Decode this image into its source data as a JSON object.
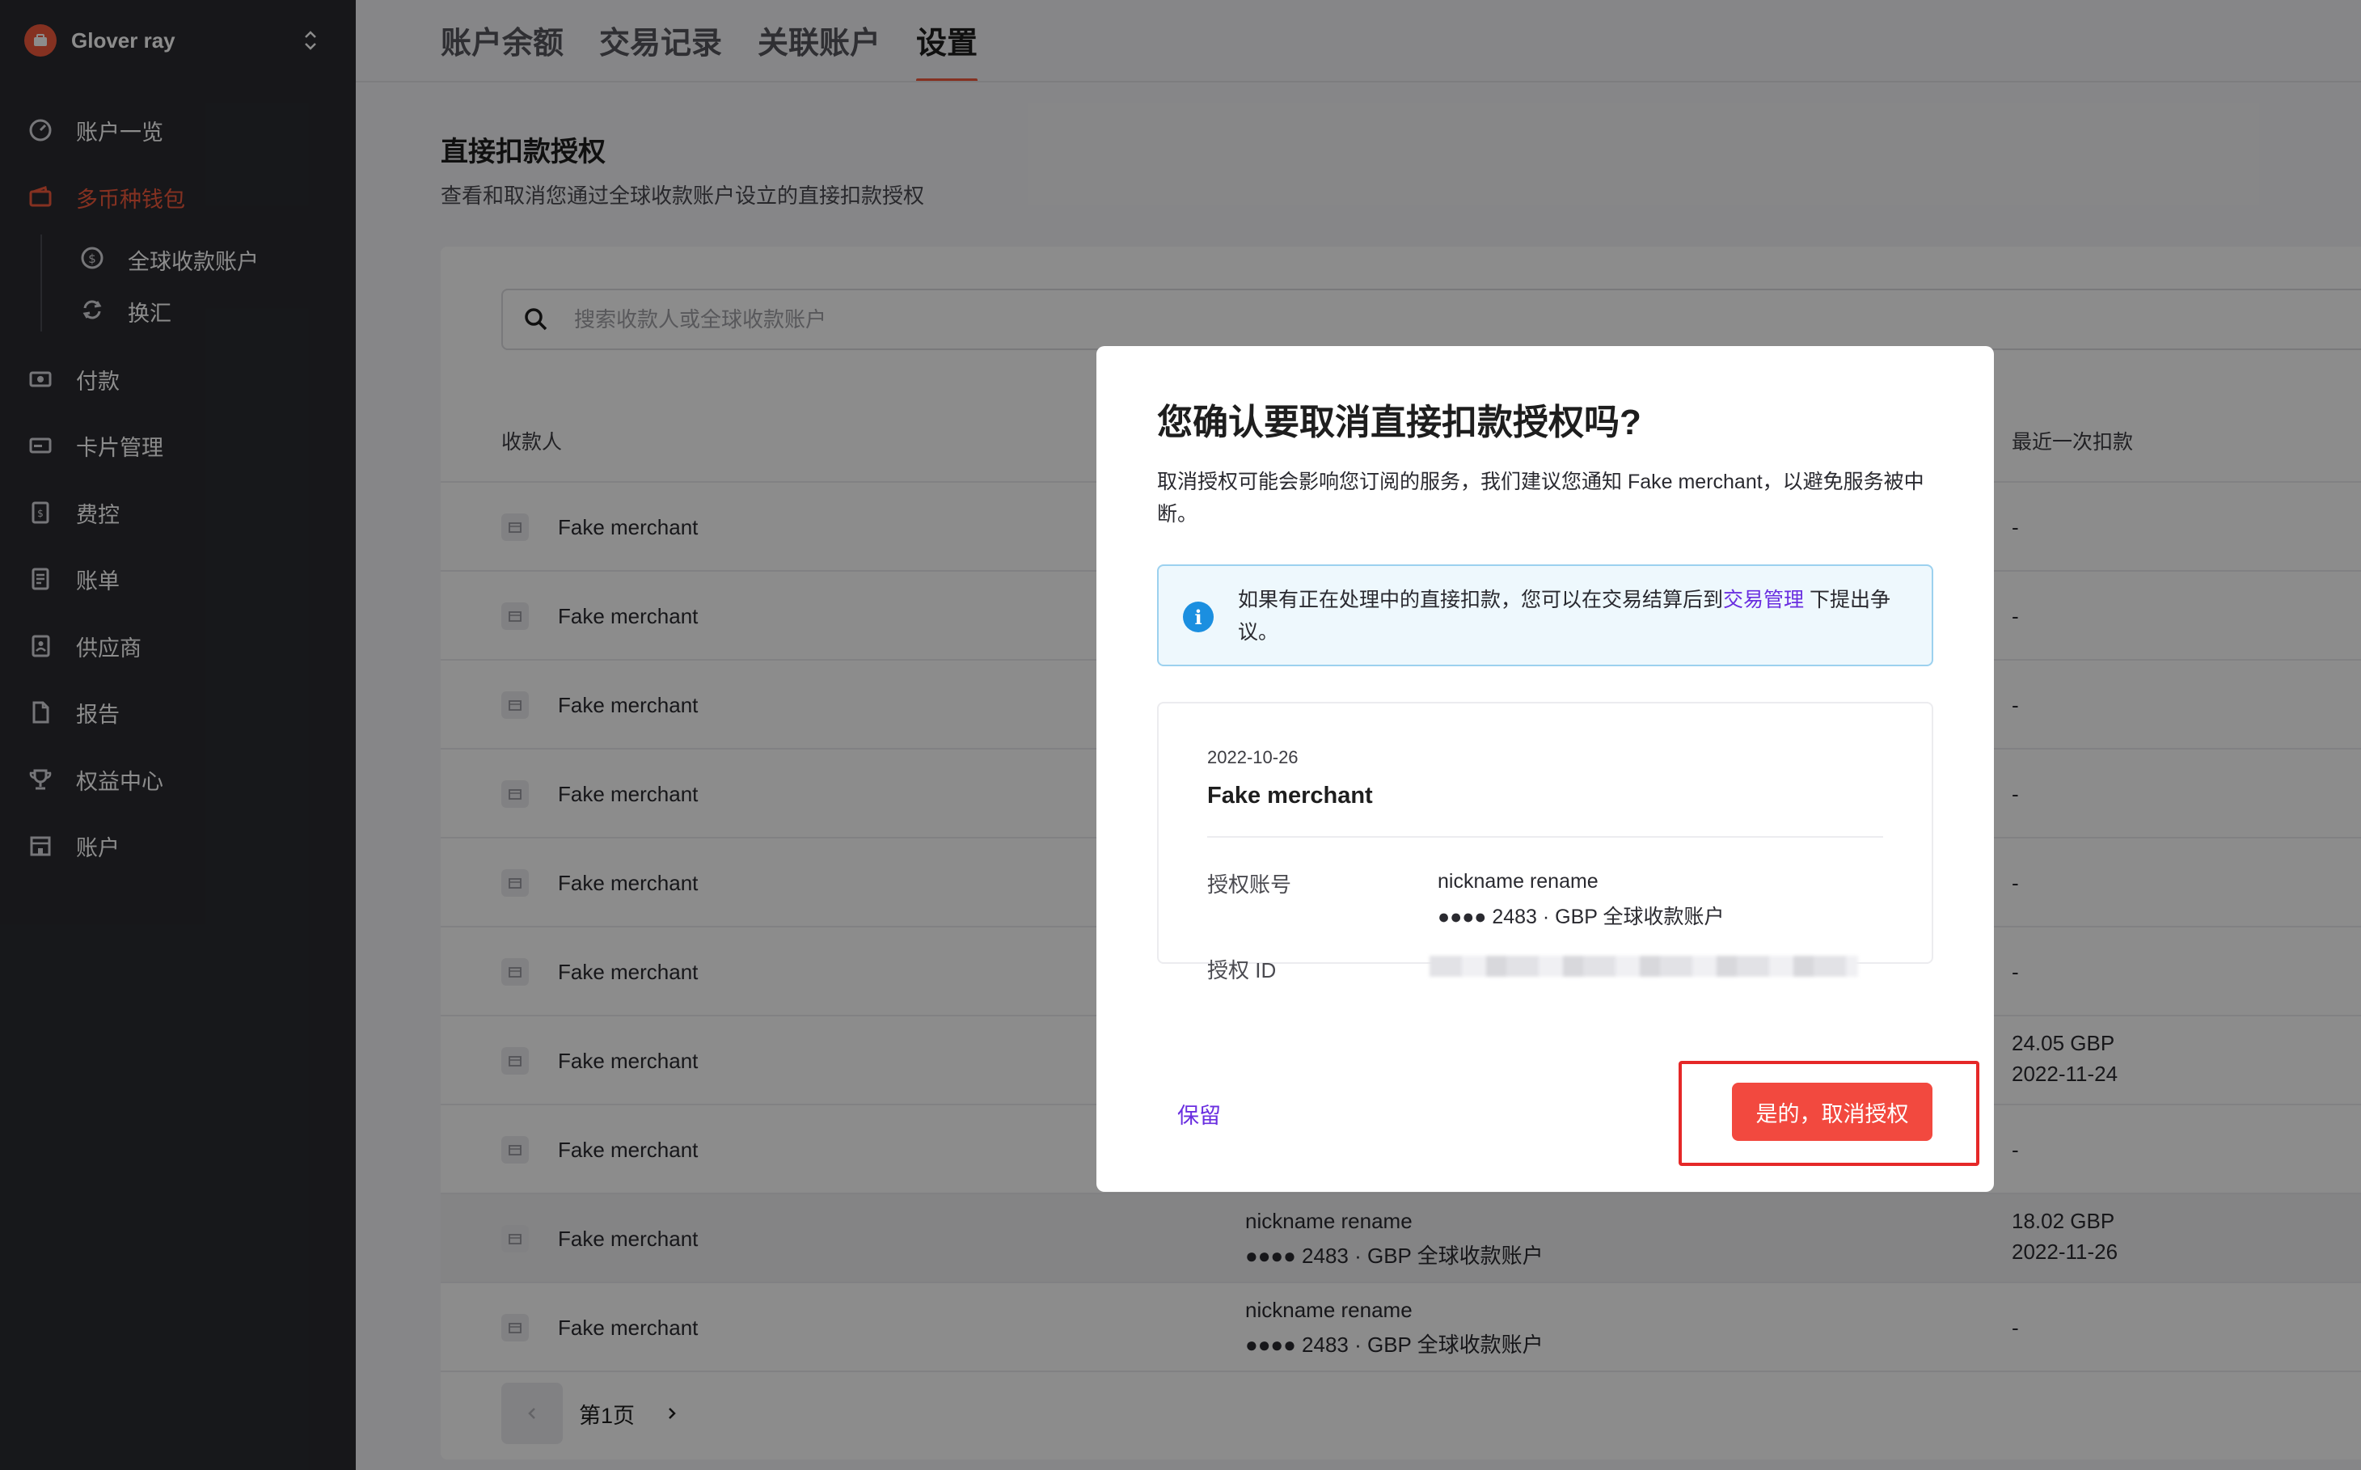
{
  "sidebar": {
    "company": "Glover ray",
    "items": [
      {
        "label": "账户一览"
      },
      {
        "label": "多币种钱包"
      },
      {
        "label": "全球收款账户"
      },
      {
        "label": "换汇"
      },
      {
        "label": "付款"
      },
      {
        "label": "卡片管理"
      },
      {
        "label": "费控"
      },
      {
        "label": "账单"
      },
      {
        "label": "供应商"
      },
      {
        "label": "报告"
      },
      {
        "label": "权益中心"
      },
      {
        "label": "账户"
      }
    ]
  },
  "tabs": [
    {
      "label": "账户余额"
    },
    {
      "label": "交易记录"
    },
    {
      "label": "关联账户"
    },
    {
      "label": "设置"
    }
  ],
  "section": {
    "title": "直接扣款授权",
    "subtitle": "查看和取消您通过全球收款账户设立的直接扣款授权"
  },
  "search": {
    "placeholder": "搜索收款人或全球收款账户"
  },
  "table": {
    "headers": {
      "payee": "收款人",
      "last_debit": "最近一次扣款"
    },
    "rows": [
      {
        "merchant": "Fake merchant",
        "last": "-"
      },
      {
        "merchant": "Fake merchant",
        "last": "-"
      },
      {
        "merchant": "Fake merchant",
        "last": "-"
      },
      {
        "merchant": "Fake merchant",
        "last": "-"
      },
      {
        "merchant": "Fake merchant",
        "last": "-"
      },
      {
        "merchant": "Fake merchant",
        "last": "-"
      },
      {
        "merchant": "Fake merchant",
        "last_amount": "24.05 GBP",
        "last_date": "2022-11-24"
      },
      {
        "merchant": "Fake merchant",
        "last": "-"
      },
      {
        "merchant": "Fake merchant",
        "account_nick": "nickname rename",
        "account_num": "●●●● 2483 · GBP 全球收款账户",
        "last_amount": "18.02 GBP",
        "last_date": "2022-11-26"
      },
      {
        "merchant": "Fake merchant",
        "account_nick": "nickname rename",
        "account_num": "●●●● 2483 · GBP 全球收款账户",
        "last": "-"
      }
    ]
  },
  "pager": {
    "label": "第1页"
  },
  "modal": {
    "title": "您确认要取消直接扣款授权吗?",
    "description": "取消授权可能会影响您订阅的服务，我们建议您通知 Fake merchant，以避免服务被中断。",
    "notice_before": "如果有正在处理中的直接扣款，您可以在交易结算后到",
    "notice_link": "交易管理",
    "notice_after": " 下提出争议。",
    "detail": {
      "date": "2022-10-26",
      "merchant": "Fake merchant",
      "account_label": "授权账号",
      "account_nick": "nickname rename",
      "account_num": "●●●● 2483 · GBP 全球收款账户",
      "id_label": "授权 ID"
    },
    "keep_label": "保留",
    "confirm_label": "是的，取消授权"
  },
  "colors": {
    "accent": "#f35a3c",
    "danger": "#f2493f",
    "link": "#6a2ee0",
    "info": "#1b8fe0"
  }
}
